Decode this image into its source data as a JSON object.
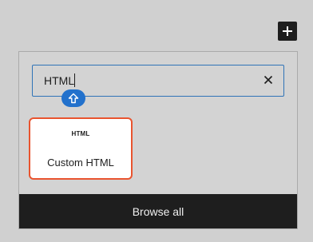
{
  "toolbar": {
    "add_icon": "plus-icon"
  },
  "search": {
    "value": "HTML",
    "placeholder": "Search",
    "clear_icon": "close-icon"
  },
  "drag_handle": {
    "icon": "arrow-up-icon",
    "color": "#2271cc"
  },
  "results": [
    {
      "icon_text": "HTML",
      "label": "Custom HTML"
    }
  ],
  "footer": {
    "browse_all_label": "Browse all"
  },
  "colors": {
    "accent": "#2f73b7",
    "selection_border": "#e9542f",
    "dark": "#1e1e1e",
    "background": "#d0d0d0"
  }
}
